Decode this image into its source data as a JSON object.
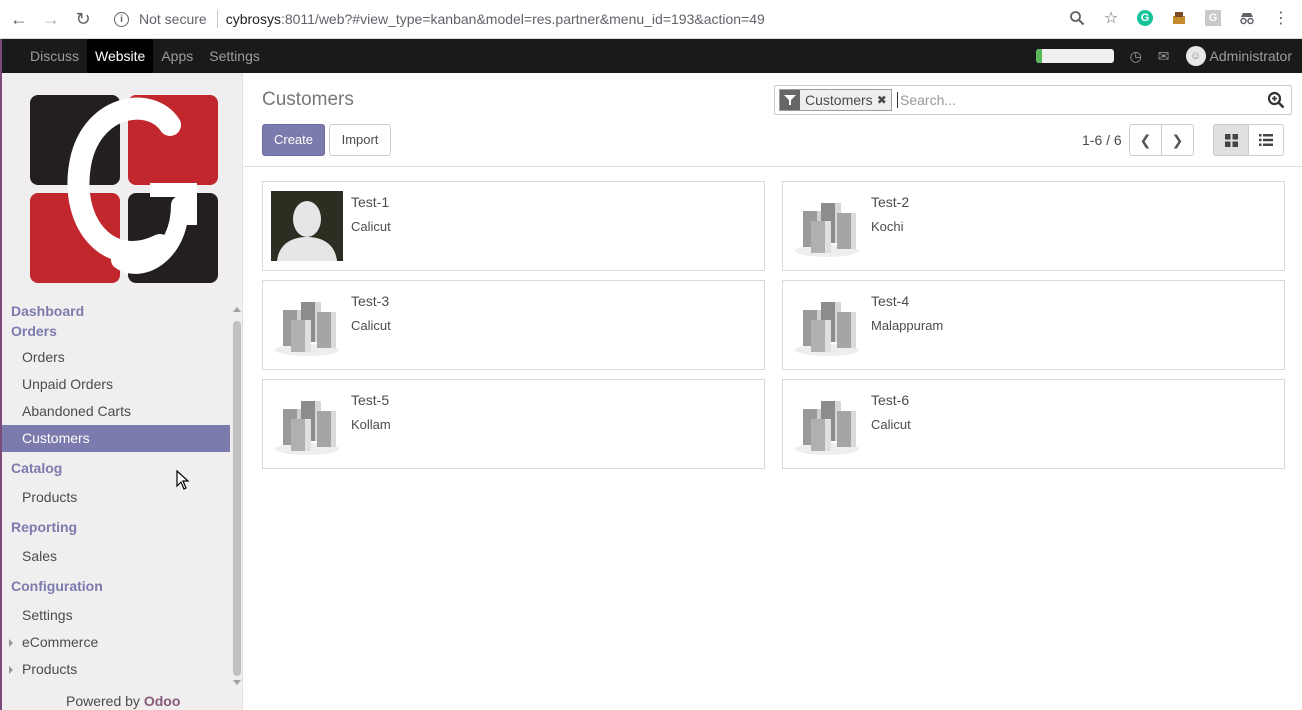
{
  "browser": {
    "not_secure": "Not secure",
    "url_host": "cybrosys",
    "url_rest": ":8011/web?#view_type=kanban&model=res.partner&menu_id=193&action=49"
  },
  "topbar": {
    "menu": [
      "Discuss",
      "Website",
      "Apps",
      "Settings"
    ],
    "active_menu": "Website",
    "progress": 0.08,
    "user": "Administrator"
  },
  "sidebar": {
    "sections": [
      {
        "title": "Dashboard",
        "items": []
      },
      {
        "title": "Orders",
        "items": [
          "Orders",
          "Unpaid Orders",
          "Abandoned Carts",
          "Customers"
        ]
      },
      {
        "title": "Catalog",
        "items": [
          "Products"
        ]
      },
      {
        "title": "Reporting",
        "items": [
          "Sales"
        ]
      },
      {
        "title": "Configuration",
        "items": [
          "Settings",
          "eCommerce",
          "Products"
        ]
      }
    ],
    "active_item": "Customers",
    "powered_by": "Powered by",
    "brand": "Odoo"
  },
  "control": {
    "title": "Customers",
    "create": "Create",
    "import": "Import",
    "facet": "Customers",
    "search_placeholder": "Search...",
    "pager": "1-6 / 6"
  },
  "customers": [
    {
      "name": "Test-1",
      "city": "Calicut",
      "image": "person-avatar"
    },
    {
      "name": "Test-2",
      "city": "Kochi",
      "image": "company-buildings"
    },
    {
      "name": "Test-3",
      "city": "Calicut",
      "image": "company-buildings"
    },
    {
      "name": "Test-4",
      "city": "Malappuram",
      "image": "company-buildings"
    },
    {
      "name": "Test-5",
      "city": "Kollam",
      "image": "company-buildings"
    },
    {
      "name": "Test-6",
      "city": "Calicut",
      "image": "company-buildings"
    }
  ],
  "colors": {
    "accent": "#7c7bad",
    "brand": "#875a7b",
    "topbar": "#1a1a1a",
    "logo_red": "#c1272d",
    "logo_dark": "#231f20"
  }
}
